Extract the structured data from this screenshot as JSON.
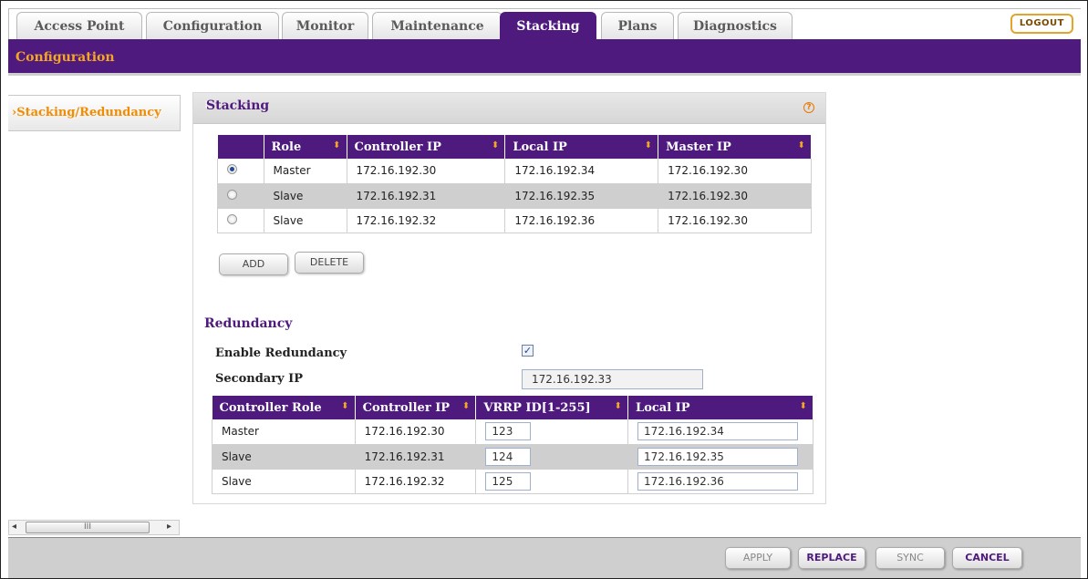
{
  "tabs": [
    {
      "label": "Access Point",
      "active": false
    },
    {
      "label": "Configuration",
      "active": false
    },
    {
      "label": "Monitor",
      "active": false
    },
    {
      "label": "Maintenance",
      "active": false
    },
    {
      "label": "Stacking",
      "active": true
    },
    {
      "label": "Plans",
      "active": false
    },
    {
      "label": "Diagnostics",
      "active": false
    }
  ],
  "logout_label": "LOGOUT",
  "subheader": "Configuration",
  "leftnav": {
    "item_label": "›Stacking/Redundancy"
  },
  "stacking": {
    "title": "Stacking",
    "help_glyph": "?",
    "headers": [
      "Role",
      "Controller IP",
      "Local IP",
      "Master IP"
    ],
    "rows": [
      {
        "selected": true,
        "role": "Master",
        "controller_ip": "172.16.192.30",
        "local_ip": "172.16.192.34",
        "master_ip": "172.16.192.30"
      },
      {
        "selected": false,
        "role": "Slave",
        "controller_ip": "172.16.192.31",
        "local_ip": "172.16.192.35",
        "master_ip": "172.16.192.30"
      },
      {
        "selected": false,
        "role": "Slave",
        "controller_ip": "172.16.192.32",
        "local_ip": "172.16.192.36",
        "master_ip": "172.16.192.30"
      }
    ],
    "add_label": "ADD",
    "delete_label": "DELETE"
  },
  "redundancy": {
    "title": "Redundancy",
    "enable_label": "Enable Redundancy",
    "enabled": true,
    "secondary_ip_label": "Secondary IP",
    "secondary_ip_value": "172.16.192.33",
    "headers": [
      "Controller Role",
      "Controller IP",
      "VRRP ID[1-255]",
      "Local IP"
    ],
    "rows": [
      {
        "role": "Master",
        "controller_ip": "172.16.192.30",
        "vrrp_id": "123",
        "local_ip": "172.16.192.34"
      },
      {
        "role": "Slave",
        "controller_ip": "172.16.192.31",
        "vrrp_id": "124",
        "local_ip": "172.16.192.35"
      },
      {
        "role": "Slave",
        "controller_ip": "172.16.192.32",
        "vrrp_id": "125",
        "local_ip": "172.16.192.36"
      }
    ]
  },
  "scrollbar": {
    "thumb_grip": "III",
    "left_arrow": "◂",
    "right_arrow": "▸"
  },
  "footer": {
    "apply_label": "APPLY",
    "replace_label": "REPLACE",
    "sync_label": "SYNC",
    "cancel_label": "CANCEL"
  },
  "sort_glyph": "⬍",
  "check_glyph": "✓",
  "colors": {
    "brand_purple": "#4f1a7e",
    "accent_orange": "#f5a623"
  }
}
